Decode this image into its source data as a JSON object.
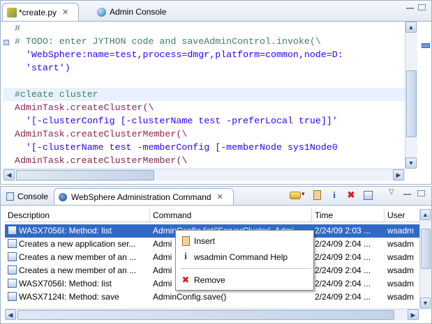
{
  "editor": {
    "tabs": [
      {
        "label": "*create.py",
        "close": "✕",
        "icon": "python-file-icon"
      },
      {
        "label": "Admin Console",
        "icon": "globe-icon"
      }
    ],
    "code_lines": [
      {
        "text": "  #",
        "cls": "c-comment"
      },
      {
        "text": "  # TODO: enter JYTHON code and saveAdminControl.invoke(\\",
        "cls": "c-comment"
      },
      {
        "text": "    'WebSphere:name=test,process=dmgr,platform=common,node=D:",
        "cls": "c-str"
      },
      {
        "text": "    'start')",
        "cls": "c-str"
      },
      {
        "text": "",
        "cls": "c-plain"
      },
      {
        "text": "  #cleate cluster",
        "cls": "c-green"
      },
      {
        "text": "  AdminTask.createCluster(\\",
        "cls": "c-fn"
      },
      {
        "text": "    '[-clusterConfig [-clusterName test -preferLocal true]]'",
        "cls": "c-str"
      },
      {
        "text": "  AdminTask.createClusterMember(\\",
        "cls": "c-fn"
      },
      {
        "text": "    '[-clusterName test -memberConfig [-memberNode sys1Node0",
        "cls": "c-str"
      },
      {
        "text": "  AdminTask.createClusterMember(\\",
        "cls": "c-fn"
      }
    ]
  },
  "console": {
    "tabs": [
      {
        "label": "Console",
        "icon": "console-icon"
      },
      {
        "label": "WebSphere Administration Command",
        "close": "✕",
        "icon": "websphere-icon"
      }
    ],
    "toolbar": {
      "insert_icon": "insert-icon",
      "help_icon": "info-icon",
      "remove_icon": "remove-icon",
      "export_icon": "export-icon",
      "help_glyph": "i",
      "remove_glyph": "✖",
      "dropdown_glyph": "▾"
    },
    "columns": [
      "Description",
      "Command",
      "Time",
      "User"
    ],
    "rows": [
      {
        "description": "WASX7056I: Method: list",
        "command": "AdminConfig.list('ServerCluster', Admi",
        "time": "2/24/09 2:03 ...",
        "user": "wsadm",
        "selected": true
      },
      {
        "description": "Creates a new application ser...",
        "command": "Admi",
        "time": "2/24/09 2:04 ...",
        "user": "wsadm",
        "selected": false
      },
      {
        "description": "Creates a new member of an ...",
        "command": "Admi",
        "time": "2/24/09 2:04 ...",
        "user": "wsadm",
        "selected": false
      },
      {
        "description": "Creates a new member of an ...",
        "command": "Admi",
        "time": "2/24/09 2:04 ...",
        "user": "wsadm",
        "selected": false
      },
      {
        "description": "WASX7056I: Method: list",
        "command": "Admi",
        "time": "2/24/09 2:04 ...",
        "user": "wsadm",
        "selected": false
      },
      {
        "description": "WASX7124I: Method: save",
        "command": "AdminConfig.save()",
        "time": "2/24/09 2:04 ...",
        "user": "wsadm",
        "selected": false
      }
    ]
  },
  "context_menu": {
    "items": [
      {
        "label": "Insert",
        "icon": "clipboard-icon"
      },
      {
        "label": "wsadmin Command Help",
        "icon": "info-icon",
        "glyph": "i"
      },
      {
        "label": "Remove",
        "icon": "red-x-icon",
        "glyph": "✖"
      }
    ]
  },
  "scroll": {
    "up": "▲",
    "down": "▼",
    "left": "◀",
    "right": "▶"
  },
  "colors": {
    "selection": "#3169c6",
    "comment": "#3f7f5f",
    "string": "#2a00ff",
    "function": "#8b2252",
    "remove": "#d42020",
    "info": "#1f4fa0"
  }
}
